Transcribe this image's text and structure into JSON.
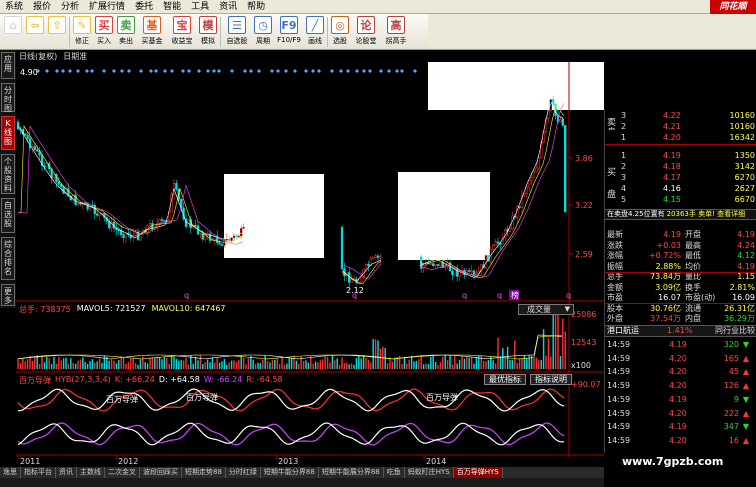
{
  "menu": [
    "系统",
    "报价",
    "分析",
    "扩展行情",
    "委托",
    "智能",
    "工具",
    "资讯",
    "帮助"
  ],
  "brand": "同花顺",
  "toolbar": [
    {
      "label": "",
      "icon": "⌂",
      "color": "#d6d6d6"
    },
    {
      "label": "",
      "icon": "⇦",
      "color": "#f0c040"
    },
    {
      "label": "",
      "icon": "⇧",
      "color": "#f0c040"
    },
    {
      "label": "修正",
      "icon": "✎",
      "color": "#f0c040"
    },
    {
      "label": "买入",
      "icon": "买",
      "color": "#e04040"
    },
    {
      "label": "卖出",
      "icon": "卖",
      "color": "#40a040"
    },
    {
      "label": "买基金",
      "icon": "基",
      "color": "#e06020"
    },
    {
      "label": "收益宝",
      "icon": "宝",
      "color": "#e04040"
    },
    {
      "label": "模拟",
      "icon": "模",
      "color": "#c04040"
    },
    {
      "label": "自选股",
      "icon": "☰",
      "color": "#4070c0"
    },
    {
      "label": "周期",
      "icon": "◷",
      "color": "#4070c0"
    },
    {
      "label": "F10/F9",
      "icon": "F9",
      "color": "#4070c0"
    },
    {
      "label": "画线",
      "icon": "╱",
      "color": "#4070c0"
    },
    {
      "label": "选股",
      "icon": "◎",
      "color": "#c06020"
    },
    {
      "label": "论股堂",
      "icon": "论",
      "color": "#c04040"
    },
    {
      "label": "拐高手",
      "icon": "高",
      "color": "#c04040"
    }
  ],
  "left_tabs": [
    {
      "label": "应用"
    },
    {
      "label": "分时图"
    },
    {
      "label": "K线图"
    },
    {
      "label": "个股资料"
    },
    {
      "label": "自选股"
    },
    {
      "label": "综合排名"
    },
    {
      "label": "更多"
    }
  ],
  "chart_header": [
    "日线(复权)",
    "日期准"
  ],
  "price_axis": [
    "3.86",
    "3.22",
    "2.59"
  ],
  "low_marker": "2.12",
  "high_marker": "4.90",
  "event_markers": [
    "q",
    "q",
    "q",
    "q",
    "榜",
    "q"
  ],
  "volume_panel": {
    "summary": "总手: 738375",
    "mavol5": "MAVOL5: 721527",
    "mavol10": "MAVOL10: 647467",
    "dropdown": "成交量",
    "axis": [
      "25086",
      "12543",
      "x100"
    ]
  },
  "indicator_panel": {
    "name": "百万导弹",
    "formula": "HYB(27,3,3,4)",
    "k": "K: +66.24",
    "d": "D: +64.58",
    "w": "W: -66.24",
    "r": "R: -64.58",
    "btn_optimize": "最优指标",
    "btn_help": "指标说明",
    "axis_top": "+90.07",
    "signals": [
      "百万导弹",
      "百万导弹",
      "百万导弹"
    ]
  },
  "x_axis": [
    "2011",
    "2012",
    "2013",
    "2014"
  ],
  "order_book": {
    "sell_label": "卖盘",
    "buy_label": "买盘",
    "rows": [
      {
        "side": "",
        "level": "3",
        "price": "4.22",
        "vol": "10160",
        "pc": "r"
      },
      {
        "side": "",
        "level": "2",
        "price": "4.21",
        "vol": "10160",
        "pc": "r"
      },
      {
        "side": "",
        "level": "1",
        "price": "4.20",
        "vol": "16342",
        "pc": "r"
      },
      {
        "side": "",
        "level": "1",
        "price": "4.19",
        "vol": "1350",
        "pc": "r"
      },
      {
        "side": "",
        "level": "2",
        "price": "4.18",
        "vol": "3142",
        "pc": "r"
      },
      {
        "side": "",
        "level": "3",
        "price": "4.17",
        "vol": "6270",
        "pc": "r"
      },
      {
        "side": "",
        "level": "4",
        "price": "4.16",
        "vol": "2627",
        "pc": "w"
      },
      {
        "side": "",
        "level": "5",
        "price": "4.15",
        "vol": "6670",
        "pc": "g"
      }
    ],
    "info": "在卖盘4.25位置有",
    "info2": "20363手 卖单! 查看详细"
  },
  "stats": [
    {
      "k1": "最新",
      "v1": "4.19",
      "c1": "r",
      "k2": "开盘",
      "v2": "4.19",
      "c2": "r"
    },
    {
      "k1": "涨跌",
      "v1": "+0.03",
      "c1": "r",
      "k2": "最高",
      "v2": "4.24",
      "c2": "r"
    },
    {
      "k1": "涨幅",
      "v1": "+0.72%",
      "c1": "r",
      "k2": "最低",
      "v2": "4.12",
      "c2": "g"
    },
    {
      "k1": "振幅",
      "v1": "2.88%",
      "c1": "y",
      "k2": "均价",
      "v2": "4.19",
      "c2": "r"
    },
    {
      "k1": "总手",
      "v1": "73.84万",
      "c1": "y",
      "k2": "量比",
      "v2": "1.15",
      "c2": "y"
    },
    {
      "k1": "金额",
      "v1": "3.09亿",
      "c1": "y",
      "k2": "换手",
      "v2": "2.81%",
      "c2": "y"
    },
    {
      "k1": "市盈",
      "v1": "16.07",
      "c1": "w",
      "k2": "市盈(动)",
      "v2": "16.09",
      "c2": "w"
    },
    {
      "k1": "股本",
      "v1": "30.76亿",
      "c1": "y",
      "k2": "流通",
      "v2": "26.31亿",
      "c2": "y"
    },
    {
      "k1": "外盘",
      "v1": "37.54万",
      "c1": "r",
      "k2": "内盘",
      "v2": "36.29万",
      "c2": "g"
    }
  ],
  "quote_title": {
    "name": "港口航运",
    "pct": "1.41%",
    "compare": "同行业比较"
  },
  "ticks": [
    {
      "time": "14:59",
      "price": "4.19",
      "vol": "320",
      "dir": "dn"
    },
    {
      "time": "14:59",
      "price": "4.20",
      "vol": "165",
      "dir": "up"
    },
    {
      "time": "14:59",
      "price": "4.20",
      "vol": "45",
      "dir": "up"
    },
    {
      "time": "14:59",
      "price": "4.20",
      "vol": "126",
      "dir": "up"
    },
    {
      "time": "14:59",
      "price": "4.19",
      "vol": "9",
      "dir": "dn"
    },
    {
      "time": "14:59",
      "price": "4.20",
      "vol": "222",
      "dir": "up"
    },
    {
      "time": "14:59",
      "price": "4.19",
      "vol": "347",
      "dir": "dn"
    },
    {
      "time": "14:59",
      "price": "4.20",
      "vol": "16",
      "dir": "up"
    }
  ],
  "bottom_tabs": [
    {
      "label": "逸思"
    },
    {
      "label": "指标平台"
    },
    {
      "label": "资讯"
    },
    {
      "label": "主数线"
    },
    {
      "label": "二次金叉"
    },
    {
      "label": "波段回踩买"
    },
    {
      "label": "短期走势88"
    },
    {
      "label": "分时红绿"
    },
    {
      "label": "短期牛能分界88"
    },
    {
      "label": "短期牛能展分界88"
    },
    {
      "label": "吃鱼"
    },
    {
      "label": "蚂蚁盯庄HYS"
    },
    {
      "label": "百万导弹HYS"
    }
  ],
  "watermark": "www.7gpzb.com"
}
